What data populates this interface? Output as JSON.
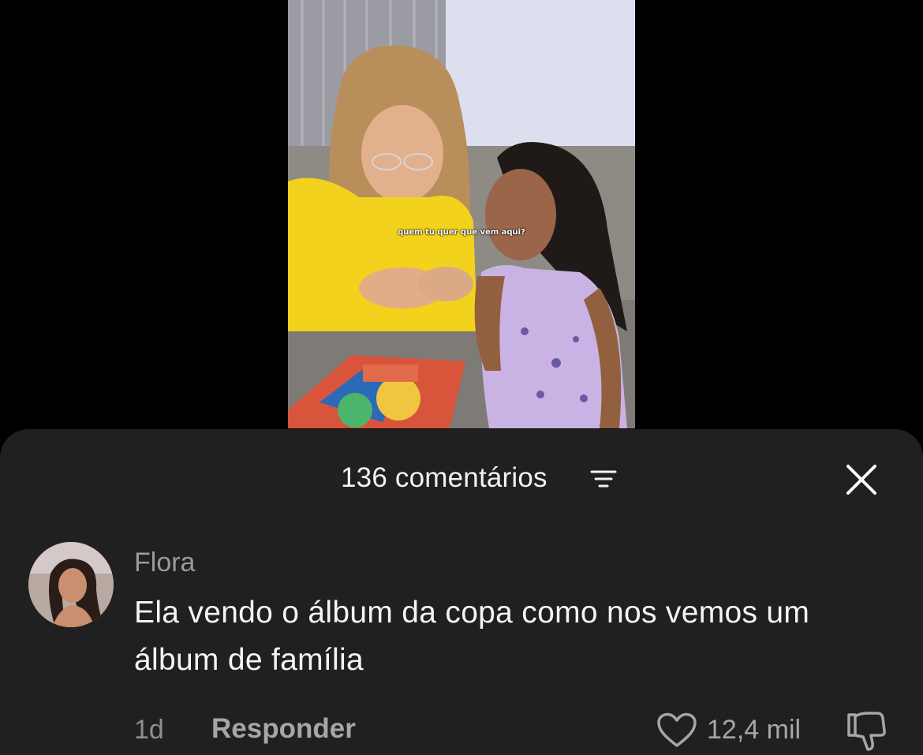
{
  "video": {
    "caption": "quem tu quer que vem aqui?"
  },
  "comments_sheet": {
    "count_label": "136 comentários",
    "sort_icon": "sort-lines-icon",
    "close_icon": "close-icon"
  },
  "comment": {
    "author": "Flora",
    "text": "Ela vendo o álbum da copa como nos vemos um álbum de família",
    "time": "1d",
    "reply_label": "Responder",
    "like_count": "12,4 mil",
    "like_icon": "heart-outline-icon",
    "dislike_icon": "thumbs-down-icon"
  },
  "colors": {
    "sheet_background": "#202020",
    "primary_text": "#f4f4f4",
    "secondary_text": "#9a9a9a"
  }
}
